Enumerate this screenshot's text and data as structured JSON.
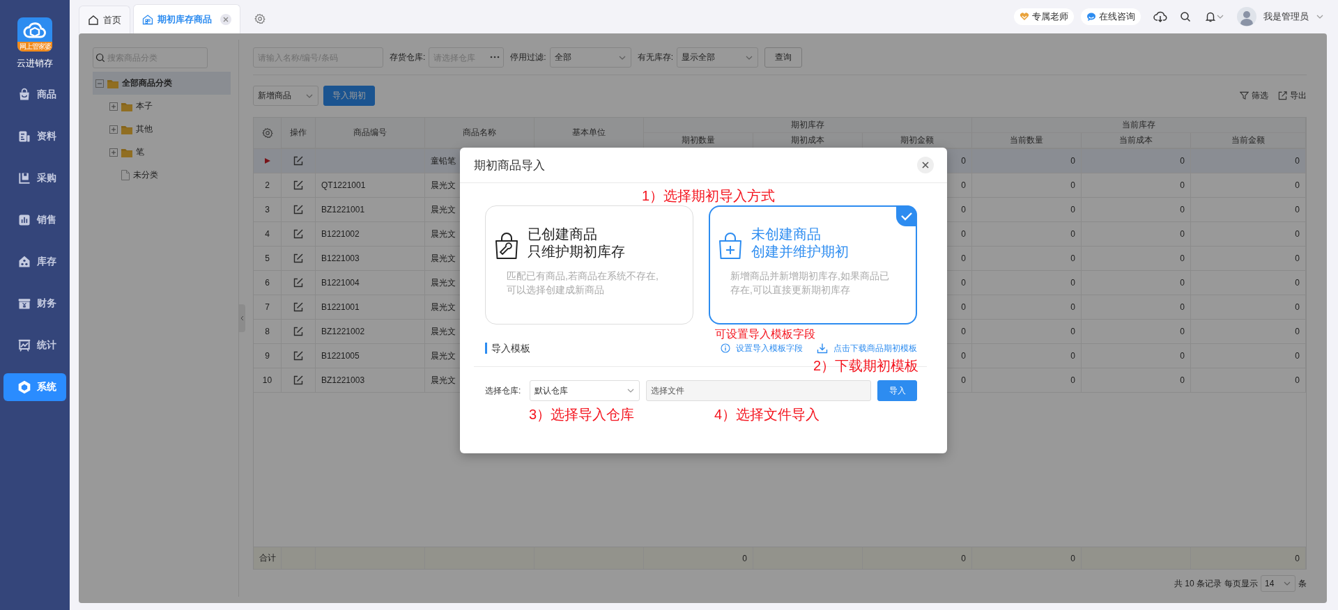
{
  "app": {
    "logo_text": "网上管家婆",
    "name": "云进销存"
  },
  "sidebar": {
    "items": [
      {
        "label": "商品",
        "selected": false
      },
      {
        "label": "资料",
        "selected": false
      },
      {
        "label": "采购",
        "selected": false
      },
      {
        "label": "销售",
        "selected": false
      },
      {
        "label": "库存",
        "selected": false
      },
      {
        "label": "财务",
        "selected": false
      },
      {
        "label": "统计",
        "selected": false
      },
      {
        "label": "系统",
        "selected": true
      }
    ]
  },
  "tabs": [
    {
      "label": "首页",
      "selected": false,
      "closable": false
    },
    {
      "label": "期初库存商品",
      "selected": true,
      "closable": true
    }
  ],
  "header": {
    "links": [
      "专属老师",
      "在线咨询"
    ],
    "user_name": "我是管理员"
  },
  "category_tree": {
    "search_placeholder": "搜索商品分类",
    "nodes": [
      {
        "label": "全部商品分类",
        "kind": "folder",
        "expanded": true,
        "selected": true,
        "children": [
          {
            "label": "本子",
            "kind": "folder",
            "expanded": false,
            "selected": false
          },
          {
            "label": "其他",
            "kind": "folder",
            "expanded": false,
            "selected": false
          },
          {
            "label": "笔",
            "kind": "folder",
            "expanded": false,
            "selected": false
          },
          {
            "label": "未分类",
            "kind": "file",
            "selected": false
          }
        ]
      }
    ]
  },
  "filters": {
    "search_placeholder": "请输入名称/编号/条码",
    "fields": [
      {
        "kind": "picker",
        "label": "存货仓库:",
        "placeholder": "请选择仓库"
      },
      {
        "kind": "select",
        "label": "停用过滤:",
        "value": "全部"
      },
      {
        "kind": "select",
        "label": "有无库存:",
        "value": "显示全部"
      }
    ],
    "query_button": "查询"
  },
  "toolbar": {
    "add_menu": "新增商品",
    "import_button": "导入期初",
    "actions": [
      "筛选",
      "导出"
    ]
  },
  "table": {
    "columns": [
      {
        "label": "操作"
      },
      {
        "label": "商品编号"
      },
      {
        "label": "商品名称"
      },
      {
        "label": "基本单位"
      },
      {
        "label": "期初库存",
        "children": [
          {
            "label": "期初数量"
          },
          {
            "label": "期初成本"
          },
          {
            "label": "期初金额"
          }
        ]
      },
      {
        "label": "当前库存",
        "children": [
          {
            "label": "当前数量"
          },
          {
            "label": "当前成本"
          },
          {
            "label": "当前金额"
          }
        ]
      }
    ],
    "rows": [
      {
        "selected": true,
        "name": "童铅笔",
        "opening_amount": "0",
        "current_qty": "0",
        "current_cost": "0",
        "current_amount": "0"
      },
      {
        "selected": false,
        "no": "2",
        "code": "QT1221001",
        "name": "晨光文",
        "opening_amount": "0",
        "current_qty": "0",
        "current_cost": "0",
        "current_amount": "0"
      },
      {
        "selected": false,
        "no": "3",
        "code": "BZ1221001",
        "name": "晨光文",
        "opening_amount": "0",
        "current_qty": "0",
        "current_cost": "0",
        "current_amount": "0"
      },
      {
        "selected": false,
        "no": "4",
        "code": "B1221002",
        "name": "晨光文",
        "opening_amount": "0",
        "current_qty": "0",
        "current_cost": "0",
        "current_amount": "0"
      },
      {
        "selected": false,
        "no": "5",
        "code": "B1221003",
        "name": "晨光文",
        "opening_amount": "0",
        "current_qty": "0",
        "current_cost": "0",
        "current_amount": "0"
      },
      {
        "selected": false,
        "no": "6",
        "code": "B1221004",
        "name": "晨光文",
        "opening_amount": "0",
        "current_qty": "0",
        "current_cost": "0",
        "current_amount": "0"
      },
      {
        "selected": false,
        "no": "7",
        "code": "B1221001",
        "name": "晨光文",
        "opening_amount": "0",
        "current_qty": "0",
        "current_cost": "0",
        "current_amount": "0"
      },
      {
        "selected": false,
        "no": "8",
        "code": "BZ1221002",
        "name": "晨光文",
        "opening_amount": "0",
        "current_qty": "0",
        "current_cost": "0",
        "current_amount": "0"
      },
      {
        "selected": false,
        "no": "9",
        "code": "B1221005",
        "name": "晨光文",
        "opening_amount": "0",
        "current_qty": "0",
        "current_cost": "0",
        "current_amount": "0"
      },
      {
        "selected": false,
        "no": "10",
        "code": "BZ1221003",
        "name": "晨光文",
        "opening_amount": "0",
        "current_qty": "0",
        "current_cost": "0",
        "current_amount": "0"
      }
    ],
    "totals": {
      "label": "合计",
      "opening_qty": "0",
      "opening_amount": "0",
      "current_qty": "0",
      "current_amount": "0"
    }
  },
  "pagination": {
    "summary": "共 10 条记录",
    "per_page_label": "每页显示",
    "per_page": "14",
    "unit": "条"
  },
  "dialog": {
    "title": "期初商品导入",
    "modes": [
      {
        "title": "已创建商品",
        "subtitle": "只维护期初库存",
        "description": "匹配已有商品,若商品在系统不存在,可以选择创建成新商品",
        "selected": false
      },
      {
        "title": "未创建商品",
        "subtitle": "创建并维护期初",
        "description": "新增商品并新增期初库存,如果商品已存在,可以直接更新期初库存",
        "selected": true
      }
    ],
    "template": {
      "heading": "导入模板",
      "links": [
        "设置导入模板字段",
        "点击下载商品期初模板"
      ]
    },
    "warehouse": {
      "label": "选择仓库:",
      "value": "默认仓库"
    },
    "file": {
      "placeholder": "选择文件"
    },
    "import_button": "导入",
    "annotations": [
      "1）选择期初导入方式",
      "可设置导入模板字段",
      "2）下载期初模板",
      "3）选择导入仓库",
      "4）选择文件导入"
    ]
  }
}
